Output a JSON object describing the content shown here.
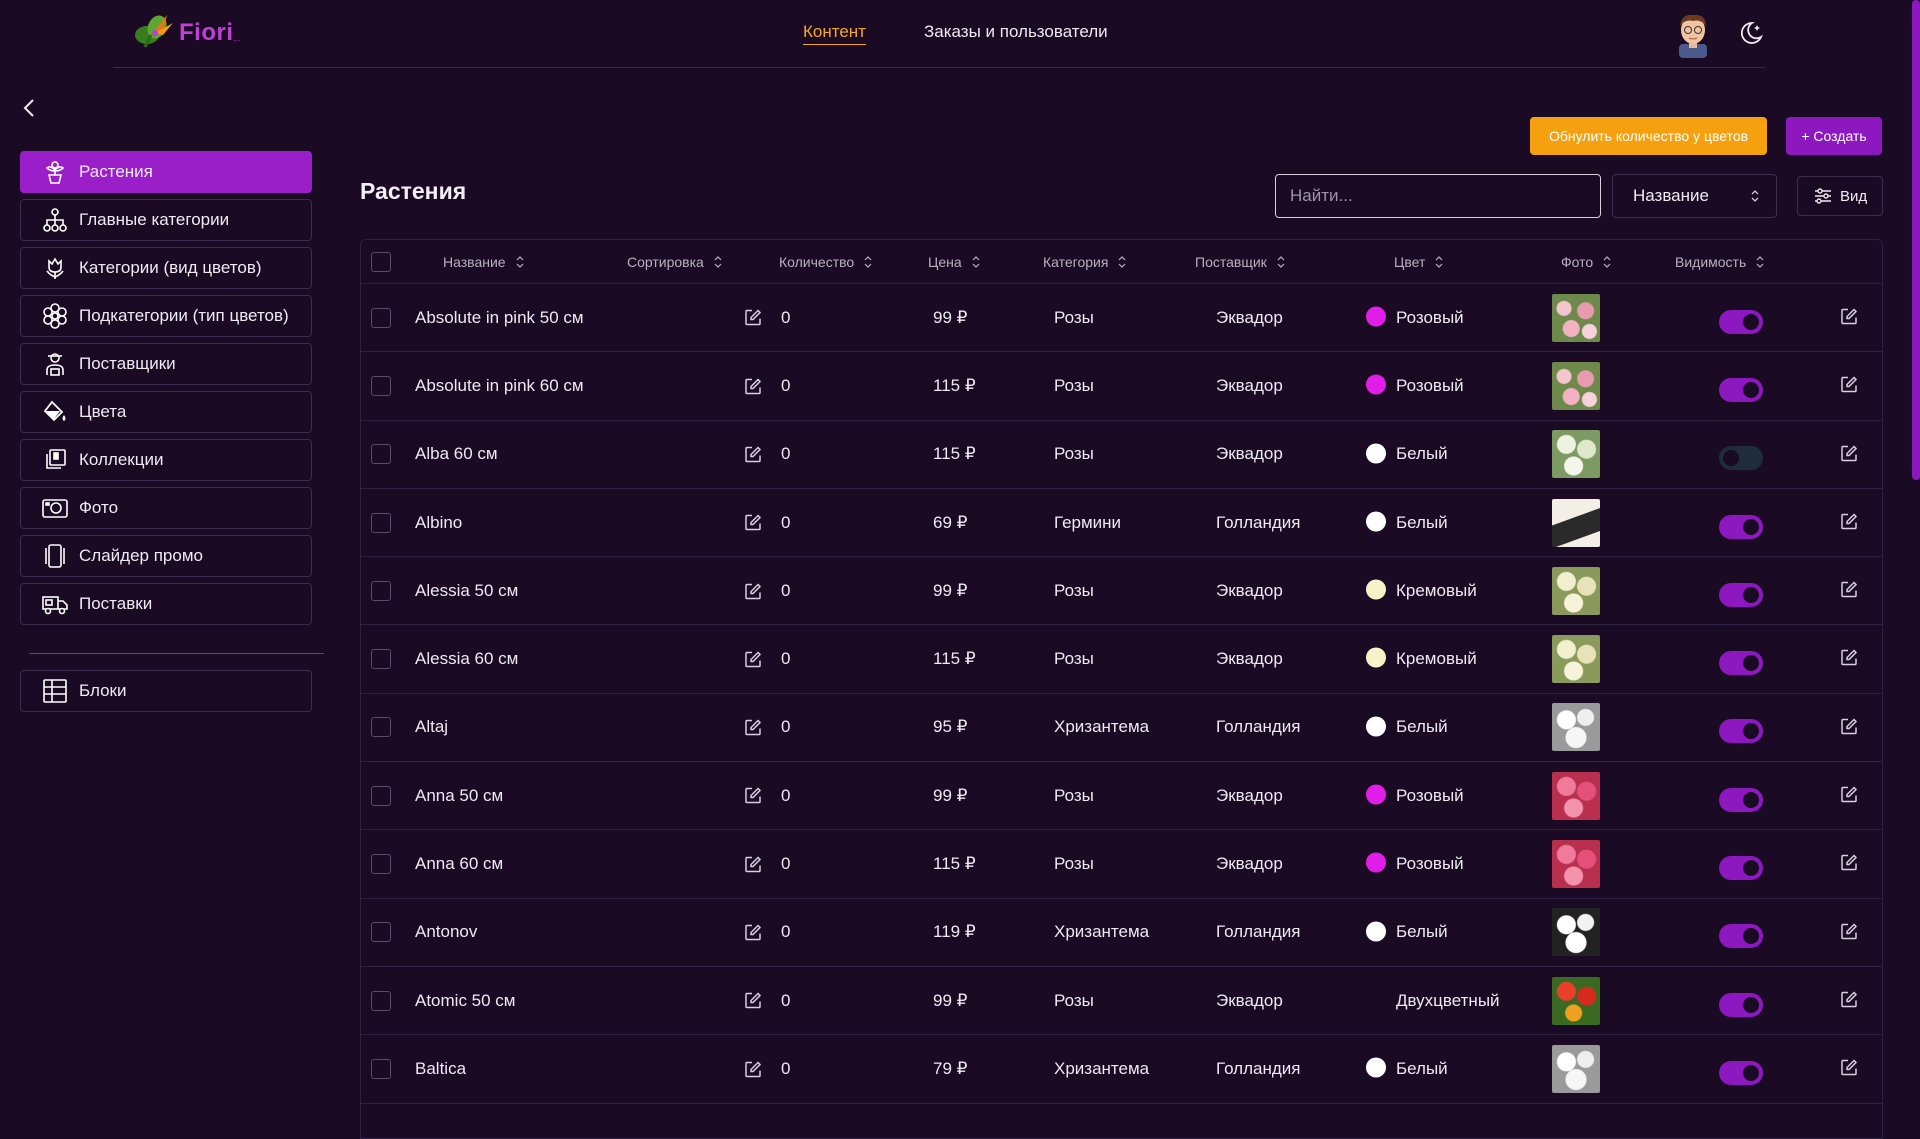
{
  "header": {
    "logo_text": "Fiori",
    "logo_suffix": "...",
    "nav": [
      {
        "label": "Контент",
        "active": true
      },
      {
        "label": "Заказы и пользователи",
        "active": false
      }
    ]
  },
  "sidebar": {
    "items": [
      {
        "label": "Растения",
        "icon": "plant-icon",
        "active": true
      },
      {
        "label": "Главные категории",
        "icon": "hierarchy-icon",
        "active": false
      },
      {
        "label": "Категории (вид цветов)",
        "icon": "tulip-icon",
        "active": false
      },
      {
        "label": "Подкатегории (тип цветов)",
        "icon": "flower-icon",
        "active": false
      },
      {
        "label": "Поставщики",
        "icon": "supplier-icon",
        "active": false
      },
      {
        "label": "Цвета",
        "icon": "paint-bucket-icon",
        "active": false
      },
      {
        "label": "Коллекции",
        "icon": "collection-icon",
        "active": false
      },
      {
        "label": "Фото",
        "icon": "camera-icon",
        "active": false
      },
      {
        "label": "Слайдер промо",
        "icon": "slider-icon",
        "active": false
      },
      {
        "label": "Поставки",
        "icon": "truck-icon",
        "active": false
      }
    ],
    "extra_items": [
      {
        "label": "Блоки",
        "icon": "grid-icon",
        "active": false
      }
    ]
  },
  "toolbar": {
    "reset_label": "Обнулить количество у цветов",
    "create_label": "+ Создать",
    "search_placeholder": "Найти...",
    "sort_value": "Название",
    "view_label": "Вид"
  },
  "page_title": "Растения",
  "table": {
    "columns": [
      "Название",
      "Сортировка",
      "Количество",
      "Цена",
      "Категория",
      "Поставщик",
      "Цвет",
      "Фото",
      "Видимость"
    ],
    "rows": [
      {
        "name": "Absolute in pink 50 см",
        "qty": "0",
        "price": "99 ₽",
        "category": "Розы",
        "supplier": "Эквадор",
        "color": "Розовый",
        "swatch": "#e01ee8",
        "visible": true,
        "photo": "pink"
      },
      {
        "name": "Absolute in pink 60 см",
        "qty": "0",
        "price": "115 ₽",
        "category": "Розы",
        "supplier": "Эквадор",
        "color": "Розовый",
        "swatch": "#e01ee8",
        "visible": true,
        "photo": "pink"
      },
      {
        "name": "Alba 60 см",
        "qty": "0",
        "price": "115 ₽",
        "category": "Розы",
        "supplier": "Эквадор",
        "color": "Белый",
        "swatch": "#ffffff",
        "visible": false,
        "photo": "white"
      },
      {
        "name": "Albino",
        "qty": "0",
        "price": "69 ₽",
        "category": "Гермини",
        "supplier": "Голландия",
        "color": "Белый",
        "swatch": "#ffffff",
        "visible": true,
        "photo": "box"
      },
      {
        "name": "Alessia 50 см",
        "qty": "0",
        "price": "99 ₽",
        "category": "Розы",
        "supplier": "Эквадор",
        "color": "Кремовый",
        "swatch": "#f8f2c8",
        "visible": true,
        "photo": "cream"
      },
      {
        "name": "Alessia 60 см",
        "qty": "0",
        "price": "115 ₽",
        "category": "Розы",
        "supplier": "Эквадор",
        "color": "Кремовый",
        "swatch": "#f8f2c8",
        "visible": true,
        "photo": "cream"
      },
      {
        "name": "Altaj",
        "qty": "0",
        "price": "95 ₽",
        "category": "Хризантема",
        "supplier": "Голландия",
        "color": "Белый",
        "swatch": "#ffffff",
        "visible": true,
        "photo": "mum"
      },
      {
        "name": "Anna 50 см",
        "qty": "0",
        "price": "99 ₽",
        "category": "Розы",
        "supplier": "Эквадор",
        "color": "Розовый",
        "swatch": "#e01ee8",
        "visible": true,
        "photo": "hotpink"
      },
      {
        "name": "Anna 60 см",
        "qty": "0",
        "price": "115 ₽",
        "category": "Розы",
        "supplier": "Эквадор",
        "color": "Розовый",
        "swatch": "#e01ee8",
        "visible": true,
        "photo": "hotpink"
      },
      {
        "name": "Antonov",
        "qty": "0",
        "price": "119 ₽",
        "category": "Хризантема",
        "supplier": "Голландия",
        "color": "Белый",
        "swatch": "#ffffff",
        "visible": true,
        "photo": "mumdark"
      },
      {
        "name": "Atomic 50 см",
        "qty": "0",
        "price": "99 ₽",
        "category": "Розы",
        "supplier": "Эквадор",
        "color": "Двухцветный",
        "swatch": "",
        "visible": true,
        "photo": "red"
      },
      {
        "name": "Baltica",
        "qty": "0",
        "price": "79 ₽",
        "category": "Хризантема",
        "supplier": "Голландия",
        "color": "Белый",
        "swatch": "#ffffff",
        "visible": true,
        "photo": "mum"
      }
    ]
  }
}
